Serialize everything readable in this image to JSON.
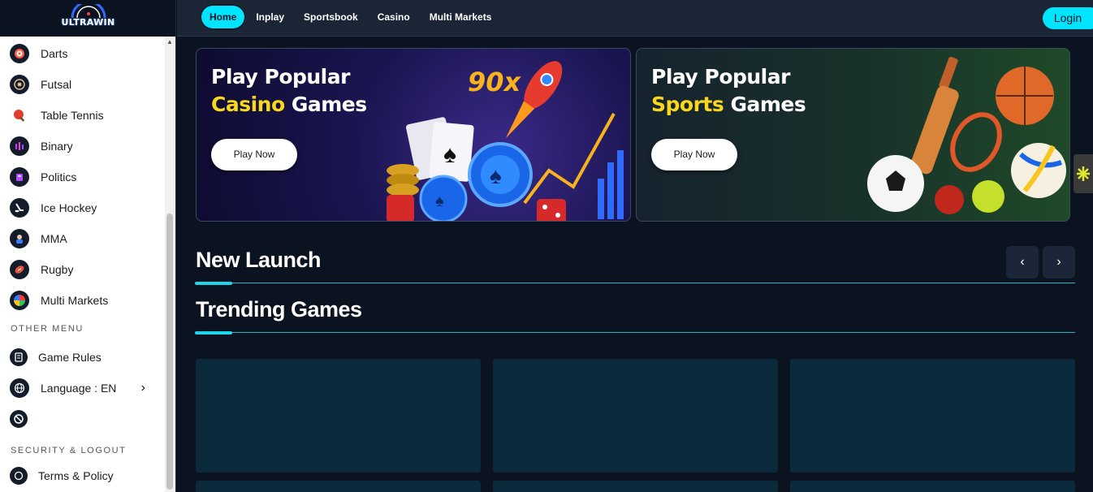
{
  "brand": {
    "name": "ULTRAWIN"
  },
  "nav": {
    "tabs": [
      {
        "label": "Home",
        "active": true
      },
      {
        "label": "Inplay"
      },
      {
        "label": "Sportsbook"
      },
      {
        "label": "Casino"
      },
      {
        "label": "Multi Markets"
      }
    ],
    "login_label": "Login"
  },
  "sidebar": {
    "sports": [
      {
        "label": "Darts",
        "icon": "darts-icon"
      },
      {
        "label": "Futsal",
        "icon": "futsal-icon"
      },
      {
        "label": "Table Tennis",
        "icon": "table-tennis-icon"
      },
      {
        "label": "Binary",
        "icon": "binary-icon"
      },
      {
        "label": "Politics",
        "icon": "politics-icon"
      },
      {
        "label": "Ice Hockey",
        "icon": "ice-hockey-icon"
      },
      {
        "label": "MMA",
        "icon": "mma-icon"
      },
      {
        "label": "Rugby",
        "icon": "rugby-icon"
      },
      {
        "label": "Multi Markets",
        "icon": "multi-markets-icon"
      }
    ],
    "other_menu_heading": "OTHER MENU",
    "other_menu": {
      "game_rules": "Game Rules",
      "language": "Language : EN"
    },
    "security_heading": "SECURITY & LOGOUT",
    "terms": "Terms & Policy"
  },
  "banners": {
    "casino": {
      "line1": "Play Popular",
      "highlight": "Casino",
      "rest": " Games",
      "button": "Play Now",
      "multiplier": "90x"
    },
    "sports": {
      "line1": "Play Popular",
      "highlight": "Sports",
      "rest": " Games",
      "button": "Play Now"
    }
  },
  "sections": {
    "new_launch": "New Launch",
    "trending": "Trending Games"
  },
  "colors": {
    "accent": "#00e5ff",
    "highlight": "#f9d71c",
    "background": "#0b1220",
    "card": "#0b2a3c"
  }
}
